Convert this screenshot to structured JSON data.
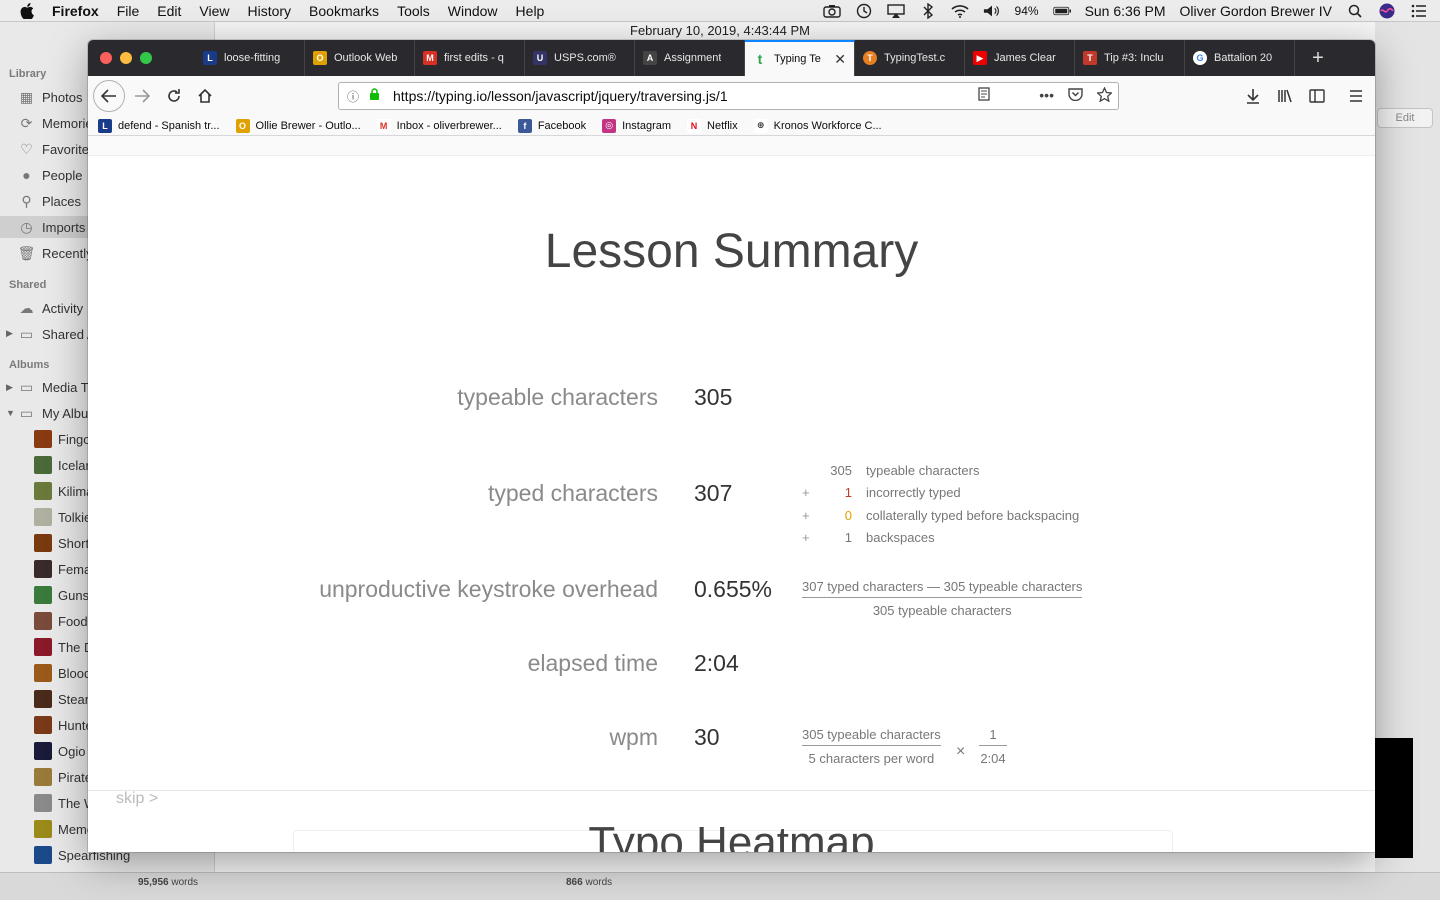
{
  "menubar": {
    "app_name": "Firefox",
    "items": [
      "File",
      "Edit",
      "View",
      "History",
      "Bookmarks",
      "Tools",
      "Window",
      "Help"
    ],
    "battery": "94%",
    "clock": "Sun 6:36 PM",
    "user": "Oliver Gordon Brewer IV"
  },
  "photos": {
    "sections": {
      "library": "Library",
      "shared": "Shared",
      "albums": "Albums"
    },
    "library_items": [
      {
        "label": "Photos",
        "icon": "photos-icon"
      },
      {
        "label": "Memories",
        "icon": "memories-icon"
      },
      {
        "label": "Favorites",
        "icon": "heart-icon"
      },
      {
        "label": "People",
        "icon": "person-icon"
      },
      {
        "label": "Places",
        "icon": "pin-icon"
      },
      {
        "label": "Imports",
        "icon": "clock-icon"
      },
      {
        "label": "Recently Deleted",
        "icon": "trash-icon"
      }
    ],
    "shared_items": [
      {
        "label": "Activity",
        "icon": "cloud-icon"
      },
      {
        "label": "Shared Albums",
        "icon": "folder-icon"
      }
    ],
    "album_groups": [
      {
        "label": "Media Types"
      },
      {
        "label": "My Albums"
      }
    ],
    "albums": [
      {
        "label": "Fingolfin",
        "color": "#8a3a10"
      },
      {
        "label": "Iceland",
        "color": "#4a6a3a"
      },
      {
        "label": "Kilimanjaro",
        "color": "#6a7a3a"
      },
      {
        "label": "Tolkien",
        "color": "#b0b0a0"
      },
      {
        "label": "Short Stories",
        "color": "#7a3a10"
      },
      {
        "label": "Female Characters",
        "color": "#3a2a2a"
      },
      {
        "label": "Guns",
        "color": "#3a7a3a"
      },
      {
        "label": "Food",
        "color": "#7a4a3a"
      },
      {
        "label": "The Dark",
        "color": "#8a1a2a"
      },
      {
        "label": "Blood",
        "color": "#9a5a1a"
      },
      {
        "label": "Steampunk",
        "color": "#4a2a1a"
      },
      {
        "label": "Hunter",
        "color": "#7a3a1a"
      },
      {
        "label": "Ogio",
        "color": "#1a1a3a"
      },
      {
        "label": "Pirates",
        "color": "#9a7a3a"
      },
      {
        "label": "The Wanderer",
        "color": "#8a8a8a"
      },
      {
        "label": "Memes",
        "color": "#9a8a1a"
      },
      {
        "label": "Spearfishing",
        "color": "#1a4a8a"
      }
    ],
    "edit_button": "Edit",
    "word_count_left": {
      "number": "95,956",
      "unit": "words"
    },
    "word_count_right": {
      "number": "866",
      "unit": "words"
    }
  },
  "firefox": {
    "date_strip": "February 10, 2019, 4:43:44 PM",
    "tabs": [
      {
        "label": "loose-fitting",
        "fav_color": "#1a3a8a",
        "fav_glyph": "L"
      },
      {
        "label": "Outlook Web",
        "fav_color": "#e0a000",
        "fav_glyph": "O"
      },
      {
        "label": "first edits - q",
        "fav_color": "#d93025",
        "fav_glyph": "M"
      },
      {
        "label": "USPS.com®",
        "fav_color": "#333366",
        "fav_glyph": "U"
      },
      {
        "label": "Assignment",
        "fav_color": "#444",
        "fav_glyph": "A"
      },
      {
        "label": "Typing Te",
        "fav_color": "#2ea44f",
        "fav_glyph": "t",
        "active": true
      },
      {
        "label": "TypingTest.c",
        "fav_color": "#e67e22",
        "fav_glyph": "T"
      },
      {
        "label": "James Clear",
        "fav_color": "#e00",
        "fav_glyph": "▶"
      },
      {
        "label": "Tip #3: Inclu",
        "fav_color": "#c0392b",
        "fav_glyph": "T"
      },
      {
        "label": "Battalion 20",
        "fav_color": "#4285f4",
        "fav_glyph": "G"
      }
    ],
    "url": "https://typing.io/lesson/javascript/jquery/traversing.js/1",
    "bookmarks": [
      {
        "label": "defend - Spanish tr...",
        "fav_color": "#1a3a8a",
        "fav_glyph": "L"
      },
      {
        "label": "Ollie Brewer - Outlo...",
        "fav_color": "#e0a000",
        "fav_glyph": "O"
      },
      {
        "label": "Inbox - oliverbrewer...",
        "fav_color": "#d93025",
        "fav_glyph": "M"
      },
      {
        "label": "Facebook",
        "fav_color": "#3b5998",
        "fav_glyph": "f"
      },
      {
        "label": "Instagram",
        "fav_color": "#c13584",
        "fav_glyph": "◎"
      },
      {
        "label": "Netflix",
        "fav_color": "#e50914",
        "fav_glyph": "N"
      },
      {
        "label": "Kronos Workforce C...",
        "fav_color": "#555",
        "fav_glyph": "⊕"
      }
    ]
  },
  "summary": {
    "title": "Lesson Summary",
    "typeable_label": "typeable characters",
    "typeable_value": "305",
    "typed_label": "typed characters",
    "typed_value": "307",
    "typed_breakdown": [
      {
        "op": "",
        "num": "305",
        "text": "typeable characters",
        "num_color": "#777"
      },
      {
        "op": "+",
        "num": "1",
        "text": "incorrectly typed",
        "num_color": "#c0392b"
      },
      {
        "op": "+",
        "num": "0",
        "text": "collaterally typed before backspacing",
        "num_color": "#e6a100"
      },
      {
        "op": "+",
        "num": "1",
        "text": "backspaces",
        "num_color": "#777"
      }
    ],
    "overhead_label": "unproductive keystroke overhead",
    "overhead_value": "0.655%",
    "overhead_numerator": "307 typed characters — 305 typeable characters",
    "overhead_denominator": "305 typeable characters",
    "elapsed_label": "elapsed time",
    "elapsed_value": "2:04",
    "wpm_label": "wpm",
    "wpm_value": "30",
    "wpm_frac1_num": "305 typeable characters",
    "wpm_frac1_den": "5 characters per word",
    "wpm_times": "×",
    "wpm_frac2_num": "1",
    "wpm_frac2_den": "2:04",
    "skip": "skip >",
    "heatmap_title": "Typo Heatmap"
  }
}
